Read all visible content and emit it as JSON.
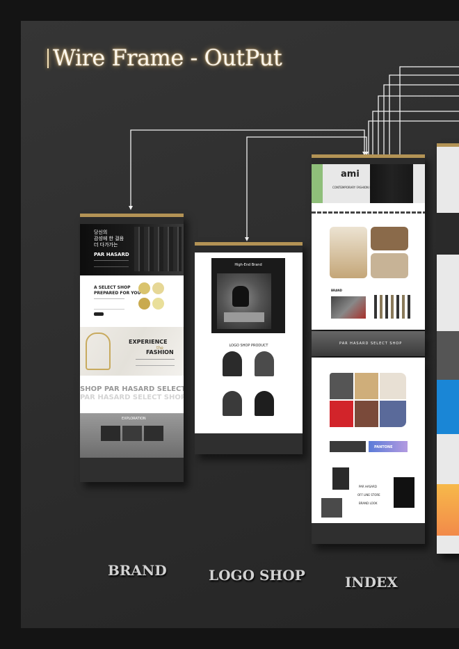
{
  "title": "Wire Frame - OutPut",
  "labels": {
    "brand": "BRAND",
    "logo_shop": "LOGO SHOP",
    "index": "INDEX"
  },
  "brand_page": {
    "hero_korean_1": "당신의",
    "hero_korean_2": "감성에 한 걸음",
    "hero_korean_3": "더 다가가는",
    "hero_name": "PAR HASARD",
    "select_shop_1": "A SELECT SHOP",
    "select_shop_2": "PREPARED FOR YOU",
    "experience": "EXPERIENCE",
    "the": "the",
    "fashion": "FASHION",
    "marquee_1": "SHOP PAR HASARD SELECT SHOP",
    "marquee_2": "PAR HASARD SELECT SHOP PAR",
    "exploration": "EXPLORATION"
  },
  "logo_shop_page": {
    "banner": "High-End Brand",
    "section": "LOGO SHOP PRODUCT"
  },
  "index_page": {
    "brand_logo": "ami",
    "brand_sub": "CONTEMPORARY FASHION BRAND",
    "brand_label": "BRAND",
    "store_banner": "PAR HASARD SELECT SHOP",
    "menu_1": "PAR HASARD",
    "menu_2": "OFF LINE STORE",
    "menu_3": "BRAND LOOK",
    "pantone": "PANTONE"
  },
  "colors": {
    "accent_gold": "#b39355",
    "title_glow": "#ebbe6e",
    "board": "#303030"
  }
}
